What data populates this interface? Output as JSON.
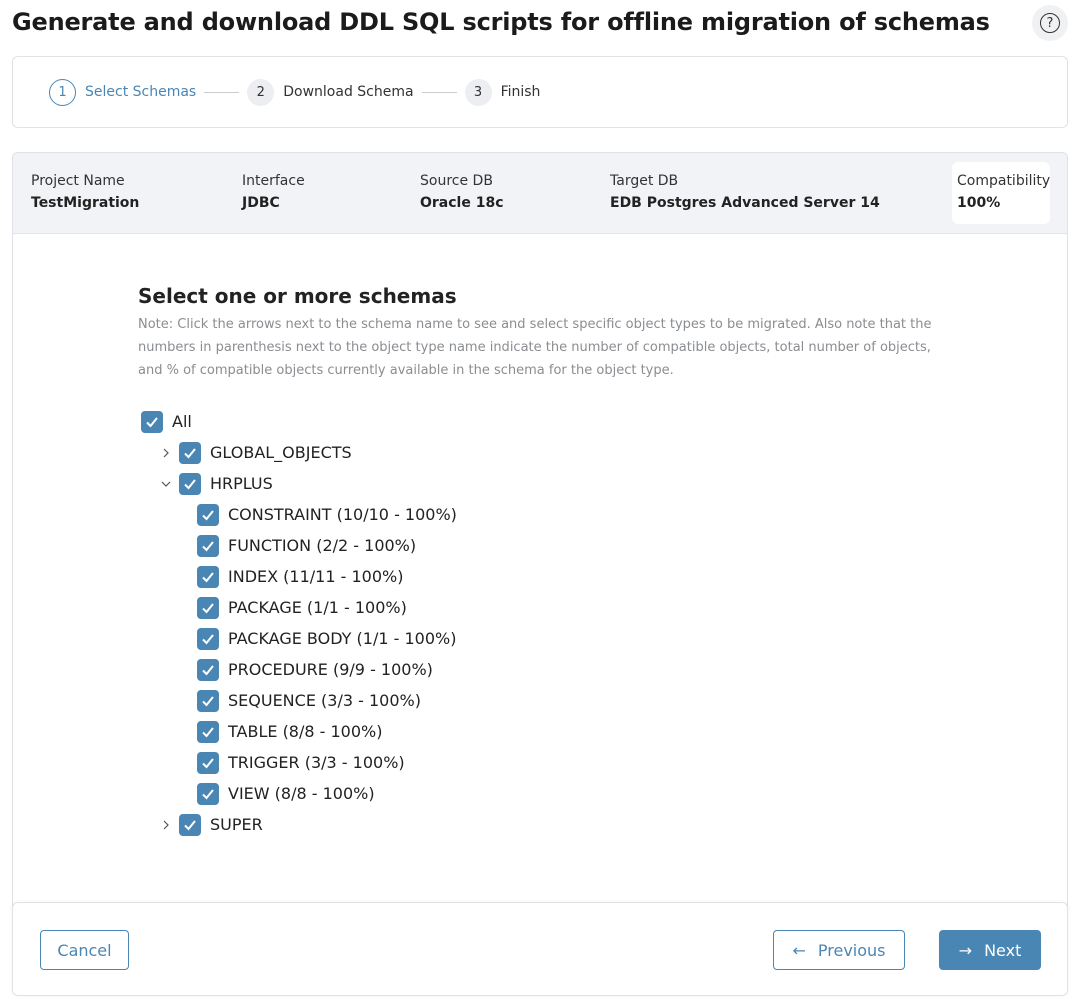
{
  "header": {
    "title": "Generate and download DDL SQL scripts for offline migration of schemas",
    "help_icon": "question-circle-icon",
    "help_glyph": "?"
  },
  "stepper": {
    "steps": [
      {
        "number": "1",
        "label": "Select Schemas",
        "state": "active"
      },
      {
        "number": "2",
        "label": "Download Schema",
        "state": "pending"
      },
      {
        "number": "3",
        "label": "Finish",
        "state": "pending"
      }
    ]
  },
  "summary": {
    "project_name": {
      "label": "Project Name",
      "value": "TestMigration"
    },
    "interface": {
      "label": "Interface",
      "value": "JDBC"
    },
    "source_db": {
      "label": "Source DB",
      "value": "Oracle 18c"
    },
    "target_db": {
      "label": "Target DB",
      "value": "EDB Postgres Advanced Server 14"
    },
    "compatibility": {
      "label": "Compatibility",
      "value": "100%"
    }
  },
  "schema_selection": {
    "title": "Select one or more schemas",
    "note": "Note: Click the arrows next to the schema name to see and select specific object types to be migrated. Also note that the numbers in parenthesis next to the object type name indicate the number of compatible objects, total number of objects, and % of compatible objects currently available in the schema for the object type.",
    "all": {
      "label": "All",
      "checked": true
    },
    "schemas": [
      {
        "name": "GLOBAL_OBJECTS",
        "checked": true,
        "expanded": false
      },
      {
        "name": "HRPLUS",
        "checked": true,
        "expanded": true,
        "object_types": [
          {
            "label": "CONSTRAINT (10/10 - 100%)",
            "checked": true
          },
          {
            "label": "FUNCTION (2/2 - 100%)",
            "checked": true
          },
          {
            "label": "INDEX (11/11 - 100%)",
            "checked": true
          },
          {
            "label": "PACKAGE (1/1 - 100%)",
            "checked": true
          },
          {
            "label": "PACKAGE BODY (1/1 - 100%)",
            "checked": true
          },
          {
            "label": "PROCEDURE (9/9 - 100%)",
            "checked": true
          },
          {
            "label": "SEQUENCE (3/3 - 100%)",
            "checked": true
          },
          {
            "label": "TABLE (8/8 - 100%)",
            "checked": true
          },
          {
            "label": "TRIGGER (3/3 - 100%)",
            "checked": true
          },
          {
            "label": "VIEW (8/8 - 100%)",
            "checked": true
          }
        ]
      },
      {
        "name": "SUPER",
        "checked": true,
        "expanded": false
      }
    ]
  },
  "footer": {
    "cancel_label": "Cancel",
    "previous_label": "Previous",
    "previous_arrow": "←",
    "next_label": "Next",
    "next_arrow": "→"
  },
  "colors": {
    "accent": "#4a86b4",
    "summary_bg": "#f1f3f6",
    "note_text": "#8a8d91"
  }
}
